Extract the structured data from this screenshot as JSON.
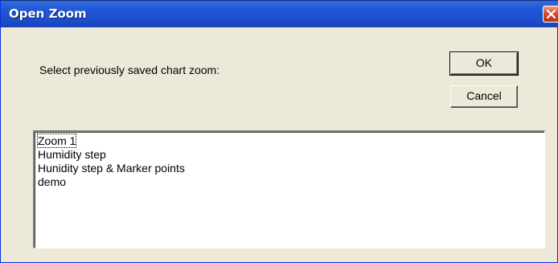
{
  "window": {
    "title": "Open Zoom"
  },
  "dialog": {
    "prompt": "Select previously saved chart zoom:",
    "ok_label": "OK",
    "cancel_label": "Cancel"
  },
  "zoom_list": {
    "items": [
      {
        "label": "Zoom 1"
      },
      {
        "label": "Humidity step"
      },
      {
        "label": "Hunidity step & Marker points"
      },
      {
        "label": "demo"
      }
    ]
  },
  "icons": {
    "close": "close-icon"
  },
  "colors": {
    "titlebar": "#1f56d6",
    "dialog_background": "#ece9d8",
    "close_button": "#d9583a"
  }
}
